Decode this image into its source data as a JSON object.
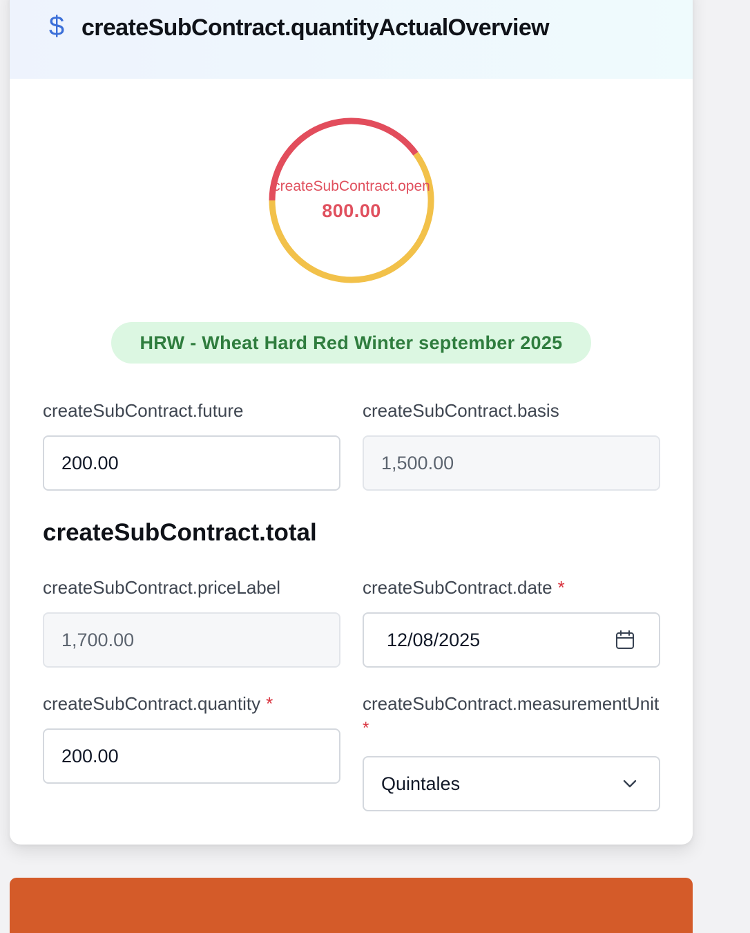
{
  "header": {
    "icon": "dollar-icon",
    "title": "createSubContract.quantityActualOverview"
  },
  "overview_chart": {
    "open_label": "createSubContract.open",
    "open_value": "800.00",
    "segments": [
      {
        "name": "open",
        "fraction": 0.4,
        "color": "#e24d5c"
      },
      {
        "name": "assigned",
        "fraction": 0.6,
        "color": "#f2c14a"
      }
    ]
  },
  "contract_badge": "HRW - Wheat Hard Red Winter september 2025",
  "form": {
    "future": {
      "label": "createSubContract.future",
      "value": "200.00"
    },
    "basis": {
      "label": "createSubContract.basis",
      "value": "1,500.00"
    },
    "total_heading": "createSubContract.total",
    "price": {
      "label": "createSubContract.priceLabel",
      "value": "1,700.00"
    },
    "date": {
      "label": "createSubContract.date",
      "required_mark": "*",
      "value": "12/08/2025"
    },
    "quantity": {
      "label": "createSubContract.quantity",
      "required_mark": "*",
      "value": "200.00"
    },
    "measurement_unit": {
      "label": "createSubContract.measurementUnit",
      "required_mark": "*",
      "value": "Quintales"
    }
  },
  "submit_button": {
    "label": ""
  }
}
